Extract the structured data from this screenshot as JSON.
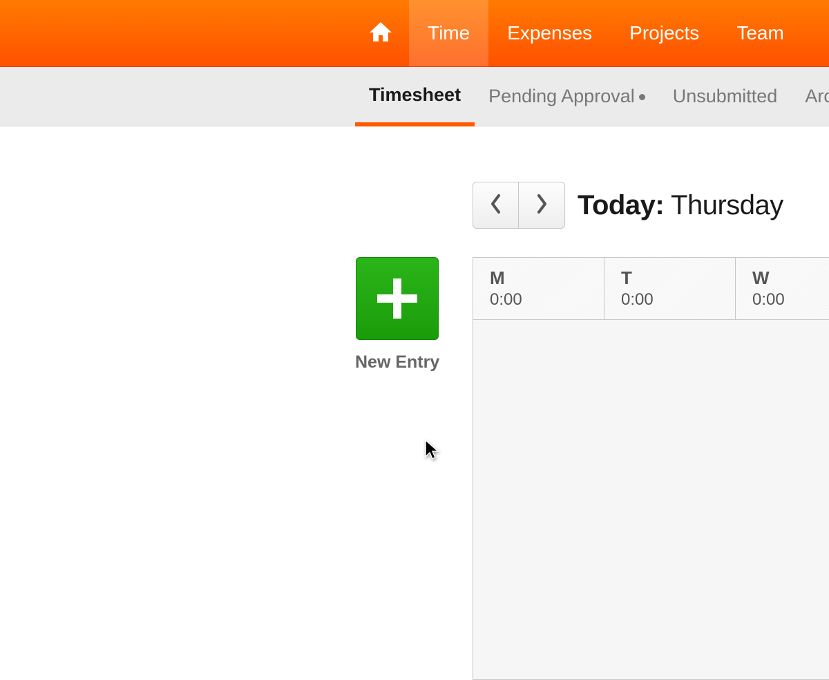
{
  "nav": {
    "items": [
      {
        "label": "Time",
        "active": true
      },
      {
        "label": "Expenses",
        "active": false
      },
      {
        "label": "Projects",
        "active": false
      },
      {
        "label": "Team",
        "active": false
      }
    ]
  },
  "subnav": {
    "items": [
      {
        "label": "Timesheet",
        "active": true,
        "dot": false
      },
      {
        "label": "Pending Approval",
        "active": false,
        "dot": true
      },
      {
        "label": "Unsubmitted",
        "active": false,
        "dot": false
      },
      {
        "label": "Archive",
        "active": false,
        "dot": false
      }
    ]
  },
  "date": {
    "prefix": "Today:",
    "day": "Thursday"
  },
  "new_entry_label": "New Entry",
  "week": {
    "days": [
      {
        "letter": "M",
        "time": "0:00"
      },
      {
        "letter": "T",
        "time": "0:00"
      },
      {
        "letter": "W",
        "time": "0:00"
      }
    ]
  }
}
